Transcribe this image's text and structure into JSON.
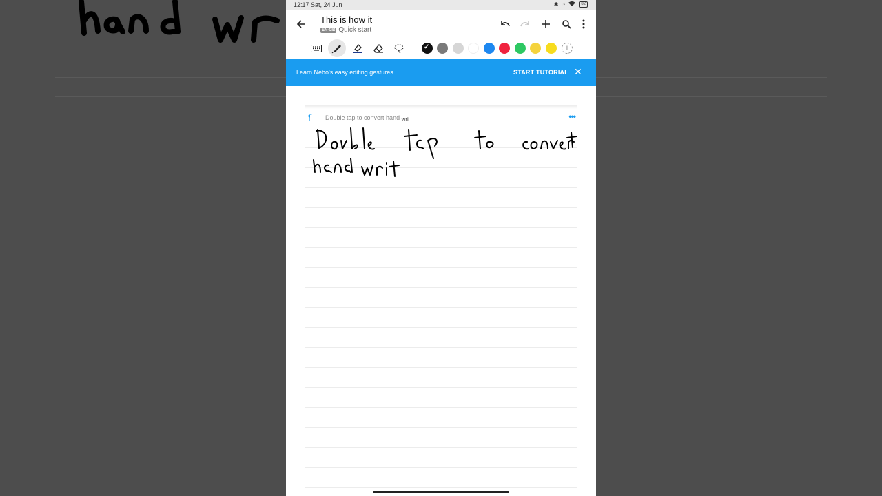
{
  "status": {
    "time": "12:17 Sat, 24 Jun",
    "battery": "82"
  },
  "appbar": {
    "title": "This is how it",
    "language_badge": "EN-GB",
    "subtitle": "Quick start"
  },
  "toolbar": {
    "tools": [
      "keyboard-icon",
      "pen-icon",
      "highlighter-icon",
      "eraser-icon",
      "lasso-icon"
    ],
    "active_tool": "pen-icon",
    "colors": [
      "#111111",
      "#7a7a7a",
      "#d6d6d6",
      "#ffffff",
      "#1e88f0",
      "#f0233f",
      "#2ec863",
      "#f5d33d",
      "#f7dc1e"
    ],
    "selected_color": "#111111"
  },
  "banner": {
    "message": "Learn Nebo's easy editing gestures.",
    "cta": "START TUTORIAL"
  },
  "block": {
    "preview_text": "Double tap to convert hand",
    "preview_suffix": "wri"
  },
  "background": {
    "handwriting": "hand wri"
  }
}
